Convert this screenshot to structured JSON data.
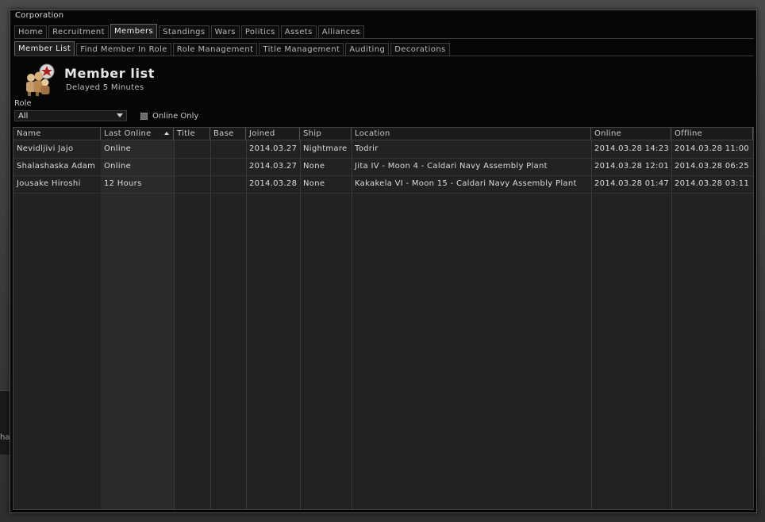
{
  "window": {
    "title": "Corporation"
  },
  "main_tabs": [
    {
      "label": "Home",
      "active": false
    },
    {
      "label": "Recruitment",
      "active": false
    },
    {
      "label": "Members",
      "active": true
    },
    {
      "label": "Standings",
      "active": false
    },
    {
      "label": "Wars",
      "active": false
    },
    {
      "label": "Politics",
      "active": false
    },
    {
      "label": "Assets",
      "active": false
    },
    {
      "label": "Alliances",
      "active": false
    }
  ],
  "sub_tabs": [
    {
      "label": "Member List",
      "active": true
    },
    {
      "label": "Find Member In Role",
      "active": false
    },
    {
      "label": "Role Management",
      "active": false
    },
    {
      "label": "Title Management",
      "active": false
    },
    {
      "label": "Auditing",
      "active": false
    },
    {
      "label": "Decorations",
      "active": false
    }
  ],
  "header": {
    "title": "Member list",
    "subtitle": "Delayed 5 Minutes",
    "icon": "corporation-members-icon"
  },
  "filters": {
    "role_label": "Role",
    "role_value": "All",
    "online_only_label": "Online Only",
    "online_only_checked": false
  },
  "table": {
    "columns": [
      "Name",
      "Last Online",
      "Title",
      "Base",
      "Joined",
      "Ship",
      "Location",
      "Online",
      "Offline"
    ],
    "sorted_column": "Last Online",
    "rows": [
      [
        "Nevidljivi Jajo",
        "Online",
        "",
        "",
        "2014.03.27",
        "Nightmare",
        "Todrir",
        "2014.03.28 14:23",
        "2014.03.28 11:00"
      ],
      [
        "Shalashaska Adam",
        "Online",
        "",
        "",
        "2014.03.27",
        "None",
        "Jita IV - Moon 4 - Caldari Navy Assembly Plant",
        "2014.03.28 12:01",
        "2014.03.28 06:25"
      ],
      [
        "Jousake Hiroshi",
        "12 Hours",
        "",
        "",
        "2014.03.28",
        "None",
        "Kakakela VI - Moon 15 - Caldari Navy Assembly Plant",
        "2014.03.28 01:47",
        "2014.03.28 03:11"
      ]
    ]
  },
  "background": {
    "partial_text": "ha"
  },
  "colors": {
    "window_bg": "#060606",
    "grid_bg": "#222222",
    "sorted_col_bg": "#2a2a2a",
    "text": "#dcdcdc"
  }
}
